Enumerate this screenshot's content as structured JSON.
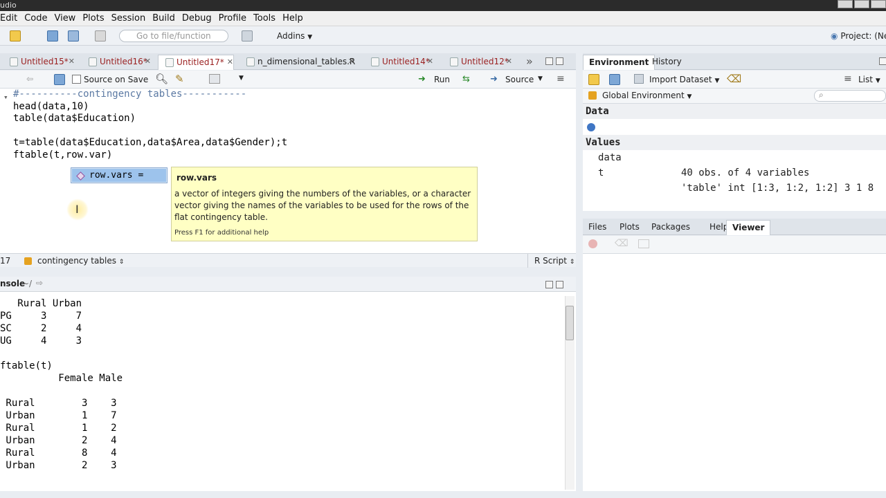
{
  "window": {
    "title": "udio"
  },
  "menu": [
    "Edit",
    "Code",
    "View",
    "Plots",
    "Session",
    "Build",
    "Debug",
    "Profile",
    "Tools",
    "Help"
  ],
  "toolbar": {
    "goto_placeholder": "Go to file/function",
    "addins_label": "Addins",
    "project_label": "Project: (Ne"
  },
  "editor": {
    "tabs": [
      {
        "label": "Untitled15*"
      },
      {
        "label": "Untitled16*"
      },
      {
        "label": "Untitled17*"
      },
      {
        "label": "n_dimensional_tables.R"
      },
      {
        "label": "Untitled14*"
      },
      {
        "label": "Untitled12*"
      }
    ],
    "source_on_save": "Source on Save",
    "run_label": "Run",
    "source_label": "Source",
    "lines": [
      "#----------contingency tables-----------",
      "head(data,10)",
      "table(data$Education)",
      "",
      "t=table(data$Education,data$Area,data$Gender);t",
      "ftable(t,row.var)"
    ],
    "autocomplete_item": "row.vars =",
    "help": {
      "title": "row.vars",
      "description": "a vector of integers giving the numbers of the variables, or a character vector giving the names of the variables to be used for the rows of the flat contingency table.",
      "footer": "Press F1 for additional help"
    },
    "status": {
      "line_no": "17",
      "section": "contingency tables",
      "file_type": "R Script"
    }
  },
  "console": {
    "title": "nsole",
    "path": "~/",
    "lines": [
      "   Rural Urban",
      "PG     3     7",
      "SC     2     4",
      "UG     4     3",
      "",
      "ftable(t)",
      "          Female Male",
      "",
      " Rural        3    3",
      " Urban        1    7",
      " Rural        1    2",
      " Urban        2    4",
      " Rural        8    4",
      " Urban        2    3"
    ]
  },
  "environment": {
    "tabs": [
      "Environment",
      "History"
    ],
    "import_dataset": "Import Dataset",
    "view_mode": "List",
    "scope": "Global Environment",
    "sections": {
      "data_header": "Data",
      "values_header": "Values"
    },
    "data_rows": [
      {
        "name": "data",
        "value": "40 obs. of 4 variables"
      }
    ],
    "value_rows": [
      {
        "name": "t",
        "value": "'table' int [1:3, 1:2, 1:2] 3 1 8"
      }
    ]
  },
  "files": {
    "tabs": [
      "Files",
      "Plots",
      "Packages",
      "Help",
      "Viewer"
    ]
  },
  "colors": {
    "accent_tab_text": "#9a1f1f",
    "comment": "#5b79a3",
    "help_bg": "#ffffc4",
    "autocomplete_sel": "#9dc3ec"
  }
}
